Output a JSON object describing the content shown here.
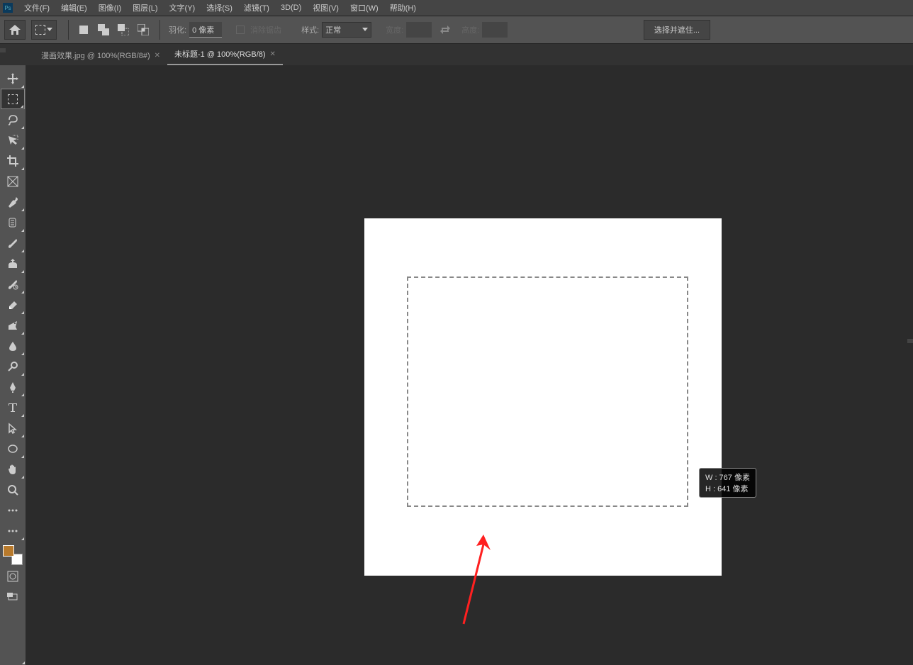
{
  "appIconLabel": "Ps",
  "menu": {
    "items": [
      "文件(F)",
      "编辑(E)",
      "图像(I)",
      "图层(L)",
      "文字(Y)",
      "选择(S)",
      "滤镜(T)",
      "3D(D)",
      "视图(V)",
      "窗口(W)",
      "帮助(H)"
    ]
  },
  "options": {
    "featherLabel": "羽化:",
    "featherValue": "0 像素",
    "antialiasLabel": "消除锯齿",
    "styleLabel": "样式:",
    "styleValue": "正常",
    "widthLabel": "宽度:",
    "heightLabel": "高度:",
    "selectMaskLabel": "选择并遮住..."
  },
  "tabs": [
    {
      "label": "漫画效果.jpg @ 100%(RGB/8#)",
      "active": false
    },
    {
      "label": "未标题-1 @ 100%(RGB/8)",
      "active": true
    }
  ],
  "colors": {
    "fg": "#b87a2c",
    "bg": "#ffffff"
  },
  "tooltip": {
    "w": "W : 767 像素",
    "h": "H : 641 像素"
  }
}
